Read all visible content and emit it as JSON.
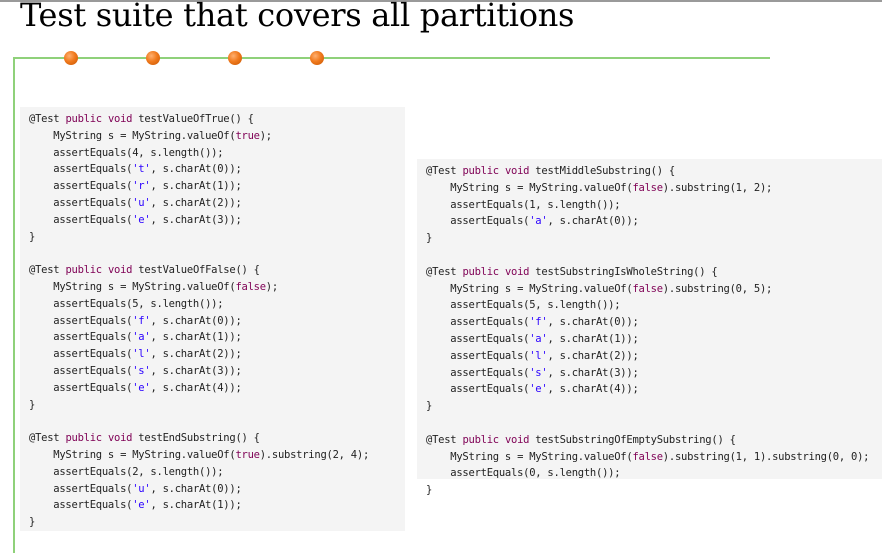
{
  "title": "Test suite that covers all partitions",
  "colors": {
    "title_rule": "#9a9a9a",
    "green_line": "#8fd17a",
    "dot_orange": "#f07a1e",
    "panel_bg": "#f4f4f4",
    "keyword": "#7f0055",
    "string": "#2a00ff"
  },
  "decor": {
    "dot_count": 4
  },
  "code_panels": [
    {
      "name": "left",
      "lines": [
        [
          {
            "t": "@Test "
          },
          {
            "t": "public void",
            "c": "kw"
          },
          {
            "t": " testValueOfTrue() {"
          }
        ],
        [
          {
            "t": "    MyString s = MyString.valueOf("
          },
          {
            "t": "true",
            "c": "kw"
          },
          {
            "t": ");"
          }
        ],
        [
          {
            "t": "    assertEquals(4, s.length());"
          }
        ],
        [
          {
            "t": "    assertEquals("
          },
          {
            "t": "'t'",
            "c": "str"
          },
          {
            "t": ", s.charAt(0));"
          }
        ],
        [
          {
            "t": "    assertEquals("
          },
          {
            "t": "'r'",
            "c": "str"
          },
          {
            "t": ", s.charAt(1));"
          }
        ],
        [
          {
            "t": "    assertEquals("
          },
          {
            "t": "'u'",
            "c": "str"
          },
          {
            "t": ", s.charAt(2));"
          }
        ],
        [
          {
            "t": "    assertEquals("
          },
          {
            "t": "'e'",
            "c": "str"
          },
          {
            "t": ", s.charAt(3));"
          }
        ],
        [
          {
            "t": "}"
          }
        ],
        [
          {
            "t": ""
          }
        ],
        [
          {
            "t": "@Test "
          },
          {
            "t": "public void",
            "c": "kw"
          },
          {
            "t": " testValueOfFalse() {"
          }
        ],
        [
          {
            "t": "    MyString s = MyString.valueOf("
          },
          {
            "t": "false",
            "c": "kw"
          },
          {
            "t": ");"
          }
        ],
        [
          {
            "t": "    assertEquals(5, s.length());"
          }
        ],
        [
          {
            "t": "    assertEquals("
          },
          {
            "t": "'f'",
            "c": "str"
          },
          {
            "t": ", s.charAt(0));"
          }
        ],
        [
          {
            "t": "    assertEquals("
          },
          {
            "t": "'a'",
            "c": "str"
          },
          {
            "t": ", s.charAt(1));"
          }
        ],
        [
          {
            "t": "    assertEquals("
          },
          {
            "t": "'l'",
            "c": "str"
          },
          {
            "t": ", s.charAt(2));"
          }
        ],
        [
          {
            "t": "    assertEquals("
          },
          {
            "t": "'s'",
            "c": "str"
          },
          {
            "t": ", s.charAt(3));"
          }
        ],
        [
          {
            "t": "    assertEquals("
          },
          {
            "t": "'e'",
            "c": "str"
          },
          {
            "t": ", s.charAt(4));"
          }
        ],
        [
          {
            "t": "}"
          }
        ],
        [
          {
            "t": ""
          }
        ],
        [
          {
            "t": "@Test "
          },
          {
            "t": "public void",
            "c": "kw"
          },
          {
            "t": " testEndSubstring() {"
          }
        ],
        [
          {
            "t": "    MyString s = MyString.valueOf("
          },
          {
            "t": "true",
            "c": "kw"
          },
          {
            "t": ").substring(2, 4);"
          }
        ],
        [
          {
            "t": "    assertEquals(2, s.length());"
          }
        ],
        [
          {
            "t": "    assertEquals("
          },
          {
            "t": "'u'",
            "c": "str"
          },
          {
            "t": ", s.charAt(0));"
          }
        ],
        [
          {
            "t": "    assertEquals("
          },
          {
            "t": "'e'",
            "c": "str"
          },
          {
            "t": ", s.charAt(1));"
          }
        ],
        [
          {
            "t": "}"
          }
        ]
      ]
    },
    {
      "name": "right",
      "lines": [
        [
          {
            "t": "@Test "
          },
          {
            "t": "public void",
            "c": "kw"
          },
          {
            "t": " testMiddleSubstring() {"
          }
        ],
        [
          {
            "t": "    MyString s = MyString.valueOf("
          },
          {
            "t": "false",
            "c": "kw"
          },
          {
            "t": ").substring(1, 2);"
          }
        ],
        [
          {
            "t": "    assertEquals(1, s.length());"
          }
        ],
        [
          {
            "t": "    assertEquals("
          },
          {
            "t": "'a'",
            "c": "str"
          },
          {
            "t": ", s.charAt(0));"
          }
        ],
        [
          {
            "t": "}"
          }
        ],
        [
          {
            "t": ""
          }
        ],
        [
          {
            "t": "@Test "
          },
          {
            "t": "public void",
            "c": "kw"
          },
          {
            "t": " testSubstringIsWholeString() {"
          }
        ],
        [
          {
            "t": "    MyString s = MyString.valueOf("
          },
          {
            "t": "false",
            "c": "kw"
          },
          {
            "t": ").substring(0, 5);"
          }
        ],
        [
          {
            "t": "    assertEquals(5, s.length());"
          }
        ],
        [
          {
            "t": "    assertEquals("
          },
          {
            "t": "'f'",
            "c": "str"
          },
          {
            "t": ", s.charAt(0));"
          }
        ],
        [
          {
            "t": "    assertEquals("
          },
          {
            "t": "'a'",
            "c": "str"
          },
          {
            "t": ", s.charAt(1));"
          }
        ],
        [
          {
            "t": "    assertEquals("
          },
          {
            "t": "'l'",
            "c": "str"
          },
          {
            "t": ", s.charAt(2));"
          }
        ],
        [
          {
            "t": "    assertEquals("
          },
          {
            "t": "'s'",
            "c": "str"
          },
          {
            "t": ", s.charAt(3));"
          }
        ],
        [
          {
            "t": "    assertEquals("
          },
          {
            "t": "'e'",
            "c": "str"
          },
          {
            "t": ", s.charAt(4));"
          }
        ],
        [
          {
            "t": "}"
          }
        ],
        [
          {
            "t": ""
          }
        ],
        [
          {
            "t": "@Test "
          },
          {
            "t": "public void",
            "c": "kw"
          },
          {
            "t": " testSubstringOfEmptySubstring() {"
          }
        ],
        [
          {
            "t": "    MyString s = MyString.valueOf("
          },
          {
            "t": "false",
            "c": "kw"
          },
          {
            "t": ").substring(1, 1).substring(0, 0);"
          }
        ],
        [
          {
            "t": "    assertEquals(0, s.length());"
          }
        ],
        [
          {
            "t": "}"
          }
        ]
      ]
    }
  ]
}
